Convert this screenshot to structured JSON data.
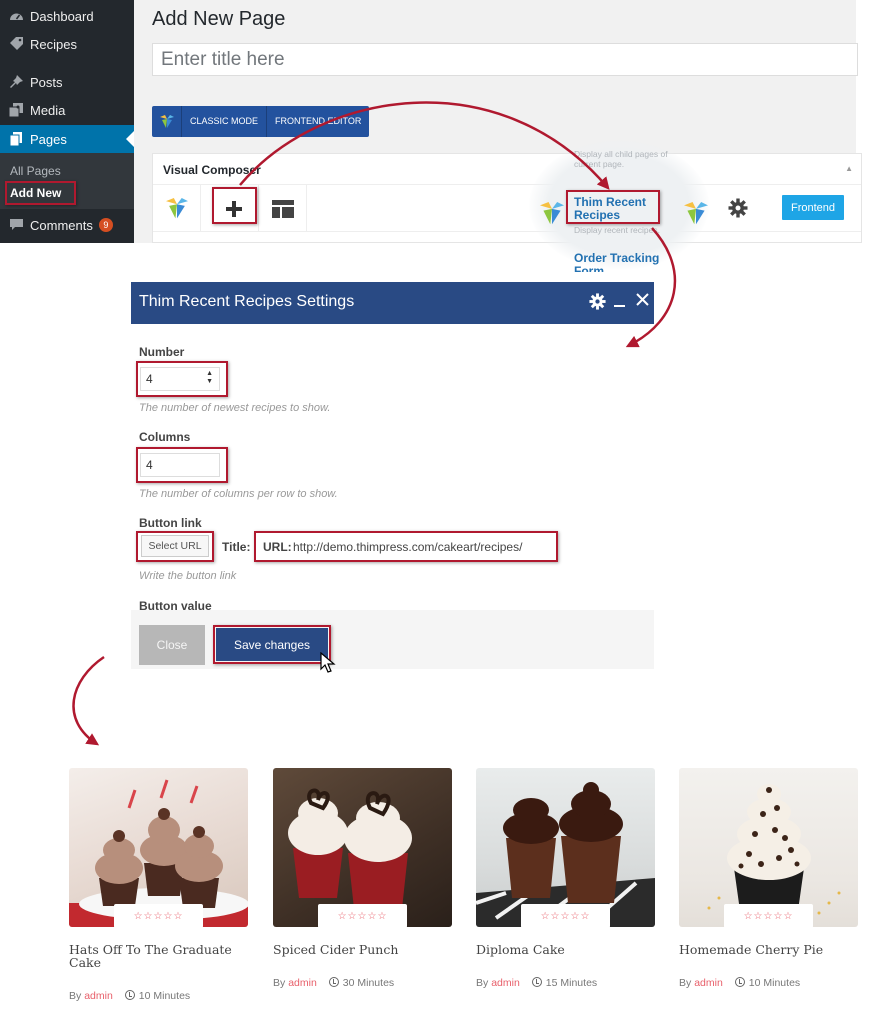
{
  "sidebar": {
    "items": [
      {
        "label": "Dashboard",
        "icon": "dashboard-icon"
      },
      {
        "label": "Recipes",
        "icon": "tag-icon"
      },
      {
        "label": "Posts",
        "icon": "pin-icon"
      },
      {
        "label": "Media",
        "icon": "media-icon"
      },
      {
        "label": "Pages",
        "icon": "pages-icon",
        "active": true
      },
      {
        "label": "Comments",
        "icon": "comment-icon",
        "badge": "9"
      }
    ],
    "submenu": [
      {
        "label": "All Pages"
      },
      {
        "label": "Add New",
        "current": true
      }
    ]
  },
  "editor": {
    "heading": "Add New Page",
    "title_placeholder": "Enter title here",
    "classic_mode": "CLASSIC MODE",
    "frontend_editor": "FRONTEND EDITOR",
    "vc_panel_title": "Visual Composer",
    "frontend_button": "Frontend"
  },
  "dropdown": {
    "faded_top": "Display all child pages of current page.",
    "highlight": "Thim Recent Recipes",
    "highlight_desc": "Display recent recipes.",
    "next_item": "Order Tracking Form"
  },
  "modal": {
    "title": "Thim Recent Recipes Settings",
    "number_label": "Number",
    "number_value": "4",
    "number_help": "The number of newest recipes to show.",
    "columns_label": "Columns",
    "columns_value": "4",
    "columns_help": "The number of columns per row to show.",
    "button_link_label": "Button link",
    "select_url": "Select URL",
    "title_label": "Title:",
    "url_label": "URL:",
    "url_value": "http://demo.thimpress.com/cakeart/recipes/",
    "button_link_help": "Write the button link",
    "button_value_label": "Button value",
    "close_button": "Close",
    "save_button": "Save changes"
  },
  "recipes": [
    {
      "title": "Hats Off To The Graduate Cake",
      "by": "By",
      "author": "admin",
      "time": "10 Minutes",
      "stars": "☆☆☆☆☆"
    },
    {
      "title": "Spiced Cider Punch",
      "by": "By",
      "author": "admin",
      "time": "30 Minutes",
      "stars": "☆☆☆☆☆"
    },
    {
      "title": "Diploma Cake",
      "by": "By",
      "author": "admin",
      "time": "15 Minutes",
      "stars": "☆☆☆☆☆"
    },
    {
      "title": "Homemade Cherry Pie",
      "by": "By",
      "author": "admin",
      "time": "10 Minutes",
      "stars": "☆☆☆☆☆"
    }
  ],
  "colors": {
    "admin_sidebar": "#23282d",
    "wp_blue": "#0073aa",
    "vc_blue": "#294a84",
    "frontend_blue": "#1ea5e6",
    "annotation_red": "#b0192f",
    "author_pink": "#e8606b"
  }
}
